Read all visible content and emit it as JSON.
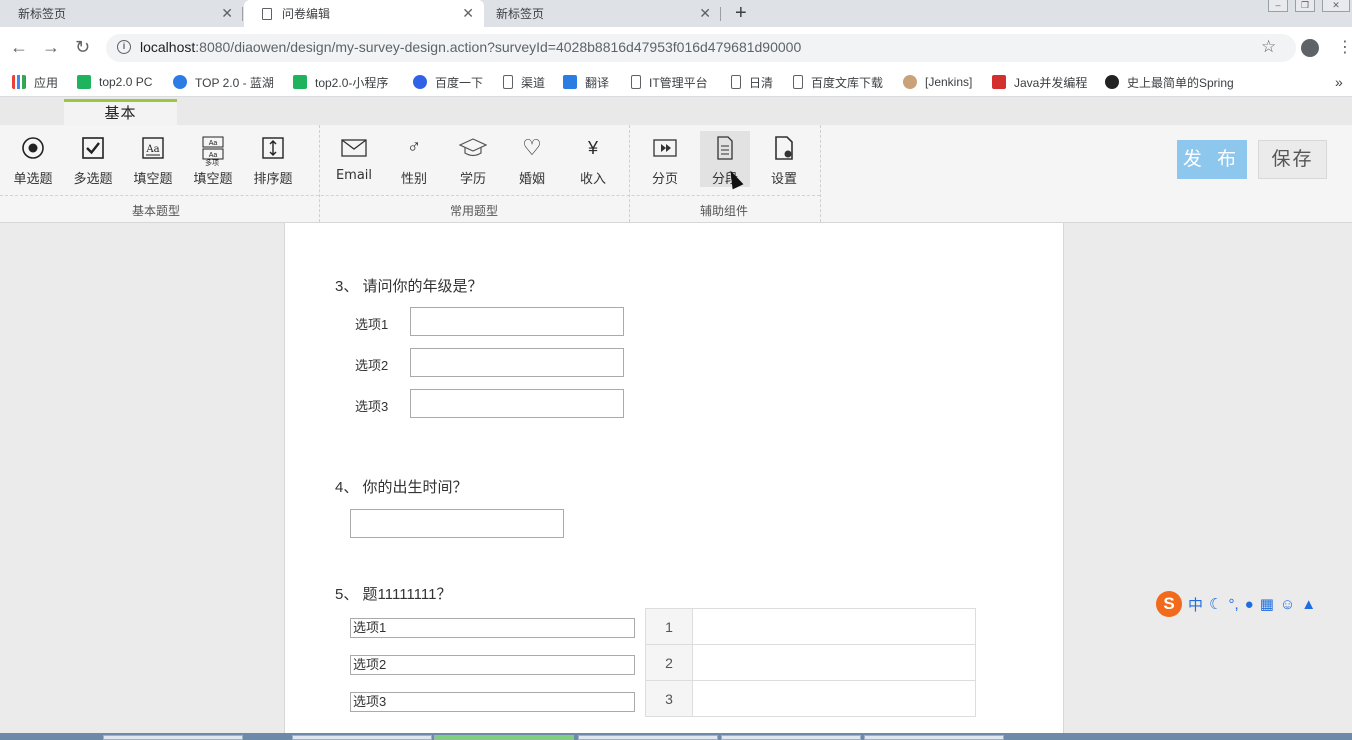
{
  "browser": {
    "tabs": [
      {
        "title": "新标签页",
        "active": false
      },
      {
        "title": "问卷编辑",
        "active": true
      },
      {
        "title": "新标签页",
        "active": false
      }
    ],
    "url_host": "localhost",
    "url_rest": ":8080/diaowen/design/my-survey-design.action?surveyId=4028b8816d47953f016d479681d90000",
    "bookmarks": [
      "应用",
      "top2.0 PC",
      "TOP 2.0 - 蓝湖",
      "top2.0-小程序",
      "百度一下",
      "渠道",
      "翻译",
      "IT管理平台",
      "日清",
      "百度文库下载",
      "[Jenkins]",
      "Java并发编程",
      "史上最简单的Spring"
    ],
    "more_bookmarks": "»"
  },
  "ribbon": {
    "tab_label": "基本",
    "groups": {
      "basic": {
        "label": "基本题型",
        "buttons": [
          {
            "label": "单选题",
            "icon": "radio-icon"
          },
          {
            "label": "多选题",
            "icon": "checkbox-icon"
          },
          {
            "label": "填空题",
            "icon": "text-fill-icon"
          },
          {
            "label": "填空题",
            "icon": "multi-fill-icon",
            "sub": "多项"
          },
          {
            "label": "排序题",
            "icon": "sort-icon"
          }
        ]
      },
      "common": {
        "label": "常用题型",
        "buttons": [
          {
            "label": "Email",
            "icon": "envelope-icon"
          },
          {
            "label": "性别",
            "icon": "gender-icon"
          },
          {
            "label": "学历",
            "icon": "graduation-cap-icon"
          },
          {
            "label": "婚姻",
            "icon": "heart-icon"
          },
          {
            "label": "收入",
            "icon": "yen-icon"
          }
        ]
      },
      "aux": {
        "label": "辅助组件",
        "buttons": [
          {
            "label": "分页",
            "icon": "page-break-icon"
          },
          {
            "label": "分段",
            "icon": "section-icon"
          },
          {
            "label": "设置",
            "icon": "settings-doc-icon"
          }
        ]
      }
    },
    "publish_label": "发 布",
    "save_label": "保存"
  },
  "survey": {
    "q3": {
      "title": "3、 请问你的年级是？",
      "options": [
        "选项1",
        "选项2",
        "选项3"
      ]
    },
    "q4": {
      "title": "4、 你的出生时间？"
    },
    "q5": {
      "title": "5、 题11111111？",
      "options": [
        "选项1",
        "选项2",
        "选项3"
      ],
      "ranks": [
        "1",
        "2",
        "3"
      ]
    }
  },
  "ime": {
    "logo": "S",
    "mode": "中"
  }
}
